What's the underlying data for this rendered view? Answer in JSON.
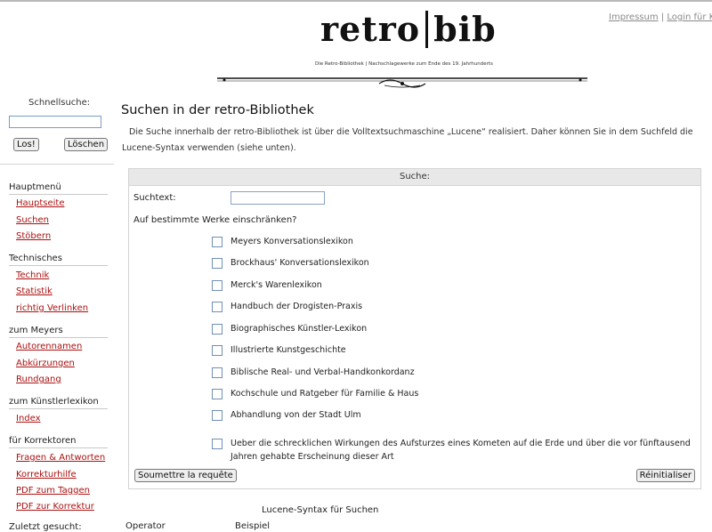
{
  "header": {
    "logo_left": "retro",
    "logo_right": "bib",
    "tagline": "Die Retro-Bibliothek | Nachschlagewerke zum Ende des 19. Jahrhunderts",
    "links": [
      "Impressum",
      "Login für Kor"
    ],
    "link_separator": "|"
  },
  "sidebar": {
    "quick_search_label": "Schnellsuche:",
    "go_button": "Los!",
    "clear_button": "Löschen",
    "sections": [
      {
        "title": "Hauptmenü",
        "items": [
          "Hauptseite",
          "Suchen",
          "Stöbern"
        ]
      },
      {
        "title": "Technisches",
        "items": [
          "Technik",
          "Statistik",
          "richtig Verlinken"
        ]
      },
      {
        "title": "zum Meyers",
        "items": [
          "Autorennamen",
          "Abkürzungen",
          "Rundgang"
        ]
      },
      {
        "title": "zum Künstlerlexikon",
        "items": [
          "Index"
        ]
      },
      {
        "title": "für Korrektoren",
        "items": [
          "Fragen & Antworten",
          "Korrekturhilfe",
          "PDF zum Taggen",
          "PDF zur Korrektur"
        ]
      }
    ],
    "last_searched": "Zuletzt gesucht:"
  },
  "main": {
    "title": "Suchen in der retro-Bibliothek",
    "intro": "Die Suche innerhalb der retro-Bibliothek ist über die Volltextsuchmaschine „Lucene“ realisiert. Daher können Sie in dem Suchfeld die Lucene-Syntax verwenden (siehe unten).",
    "search": {
      "header": "Suche:",
      "text_label": "Suchtext:",
      "text_value": "",
      "restrict_label": "Auf bestimmte Werke einschränken?",
      "works": [
        "Meyers Konversationslexikon",
        "Brockhaus' Konversationslexikon",
        "Merck's Warenlexikon",
        "Handbuch der Drogisten-Praxis",
        "Biographisches Künstler-Lexikon",
        "Illustrierte Kunstgeschichte",
        "Biblische Real- und Verbal-Handkonkordanz",
        "Kochschule und Ratgeber für Familie & Haus",
        "Abhandlung von der Stadt Ulm",
        "Ueber die schrecklichen Wirkungen des Aufsturzes eines Kometen auf die Erde und über die vor fünftausend Jahren gehabte Erscheinung dieser Art"
      ],
      "submit_button": "Soumettre la requête",
      "reset_button": "Réinitialiser"
    },
    "lucene": {
      "title": "Lucene-Syntax für Suchen",
      "col_operator": "Operator",
      "col_example": "Beispiel"
    }
  },
  "colors": {
    "link": "#aa1111",
    "border": "#d4d4d4",
    "header_bg": "#e8e8e8"
  }
}
